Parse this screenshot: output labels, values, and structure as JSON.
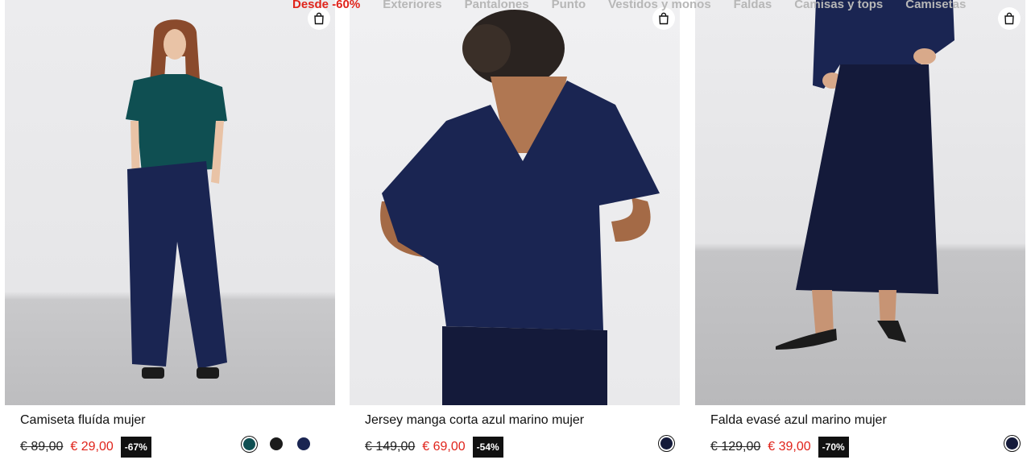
{
  "category_nav": [
    {
      "label": "Desde -60%",
      "highlight": true
    },
    {
      "label": "Exteriores",
      "highlight": false
    },
    {
      "label": "Pantalones",
      "highlight": false
    },
    {
      "label": "Punto",
      "highlight": false
    },
    {
      "label": "Vestidos y monos",
      "highlight": false
    },
    {
      "label": "Faldas",
      "highlight": false
    },
    {
      "label": "Camisas y tops",
      "highlight": false
    },
    {
      "label": "Camisetas",
      "highlight": false
    }
  ],
  "icons": {
    "add_to_bag": "shopping-bag-icon"
  },
  "colors": {
    "sale_red": "#e0241b",
    "badge_bg": "#111111",
    "navy": "#1a2552",
    "teal": "#0f4f52"
  },
  "products": [
    {
      "title": "Camiseta fluída mujer",
      "old_price": "€ 89,00",
      "new_price": "€ 29,00",
      "discount": "-67%",
      "swatches": [
        {
          "color": "#0f4f52",
          "selected": true
        },
        {
          "color": "#1b1b1b",
          "selected": false
        },
        {
          "color": "#1a2552",
          "selected": false
        }
      ]
    },
    {
      "title": "Jersey manga corta azul marino mujer",
      "old_price": "€ 149,00",
      "new_price": "€ 69,00",
      "discount": "-54%",
      "swatches": [
        {
          "color": "#141a3a",
          "selected": true
        }
      ]
    },
    {
      "title": "Falda evasé azul marino mujer",
      "old_price": "€ 129,00",
      "new_price": "€ 39,00",
      "discount": "-70%",
      "swatches": [
        {
          "color": "#141a3a",
          "selected": true
        }
      ]
    }
  ]
}
